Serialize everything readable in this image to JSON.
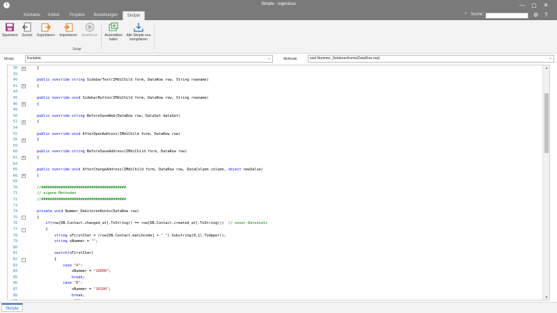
{
  "window": {
    "title": "Skripte - ingenious",
    "controls": {
      "minimize": "—",
      "maximize": "▢",
      "close": "✕"
    }
  },
  "ribbon_tabs": [
    "Kontakte",
    "Artikel",
    "Projekte",
    "Bestellungen",
    "Skripte"
  ],
  "active_tab": "Skripte",
  "search": {
    "label": "Suche:",
    "value": ""
  },
  "ribbon": {
    "buttons": [
      {
        "label": "Speichern",
        "icon": "save-icon"
      },
      {
        "label": "Zurück",
        "icon": "back-icon"
      },
      {
        "label": "Exportieren",
        "icon": "export-icon"
      },
      {
        "label": "Importieren",
        "icon": "import-icon"
      },
      {
        "label": "Ausführen",
        "icon": "run-icon",
        "disabled": true
      },
      {
        "label": "Assemblies laden",
        "icon": "assemblies-icon"
      },
      {
        "label": "Alle Skripte neu kompilieren",
        "icon": "compile-icon"
      }
    ],
    "group_label": "Skript"
  },
  "module": {
    "label": "Modul",
    "value": "Kontakte"
  },
  "method": {
    "label": "Methode",
    "value": "void Nummer_DebitorenKonto(DataRow row)"
  },
  "code_lines": [
    {
      "n": 36,
      "fold": "+",
      "segs": [
        {
          "t": "{"
        }
      ]
    },
    {
      "n": 39,
      "segs": []
    },
    {
      "n": 40,
      "segs": [
        {
          "t": "public override string ",
          "c": "kw"
        },
        {
          "t": "SidebarText(IMdiChild form, DataRow row, String rowname)"
        }
      ]
    },
    {
      "n": 41,
      "fold": "+",
      "segs": [
        {
          "t": "{"
        }
      ]
    },
    {
      "n": 44,
      "segs": []
    },
    {
      "n": 45,
      "segs": [
        {
          "t": "public override void ",
          "c": "kw"
        },
        {
          "t": "SidebarButton(IMdiChild form, DataRow row, String rowname)"
        }
      ]
    },
    {
      "n": 46,
      "fold": "+",
      "segs": [
        {
          "t": "{"
        }
      ]
    },
    {
      "n": 49,
      "segs": []
    },
    {
      "n": 50,
      "segs": [
        {
          "t": "public override string ",
          "c": "kw"
        },
        {
          "t": "BeforeSaveWeb(DataRow row, DataSet dataSet)"
        }
      ]
    },
    {
      "n": 51,
      "fold": "+",
      "segs": [
        {
          "t": "{"
        }
      ]
    },
    {
      "n": 54,
      "segs": []
    },
    {
      "n": 55,
      "segs": [
        {
          "t": "public override void ",
          "c": "kw"
        },
        {
          "t": "AfterOpenAddress(IMdiChild form, DataRow row)"
        }
      ]
    },
    {
      "n": 56,
      "fold": "+",
      "segs": [
        {
          "t": "{"
        }
      ]
    },
    {
      "n": 59,
      "segs": []
    },
    {
      "n": 60,
      "segs": [
        {
          "t": "public override string ",
          "c": "kw"
        },
        {
          "t": "BeforeSaveAddress(IMdiChild form, DataRow row)"
        }
      ]
    },
    {
      "n": 61,
      "fold": "+",
      "segs": [
        {
          "t": "{"
        }
      ]
    },
    {
      "n": 64,
      "segs": []
    },
    {
      "n": 65,
      "segs": [
        {
          "t": "public override void ",
          "c": "kw"
        },
        {
          "t": "AfterChangeAddress(IMdiChild form, DataRow row, DataColumn column, "
        },
        {
          "t": "object",
          "c": "kw"
        },
        {
          "t": " newValue)"
        }
      ]
    },
    {
      "n": 66,
      "fold": "+",
      "segs": [
        {
          "t": "{"
        }
      ]
    },
    {
      "n": 69,
      "segs": []
    },
    {
      "n": 70,
      "segs": [
        {
          "t": "//#######################################",
          "c": "com"
        }
      ]
    },
    {
      "n": 71,
      "segs": [
        {
          "t": "// eigene Methoden",
          "c": "com"
        }
      ]
    },
    {
      "n": 72,
      "segs": [
        {
          "t": "//#######################################",
          "c": "com"
        }
      ]
    },
    {
      "n": 73,
      "segs": []
    },
    {
      "n": 74,
      "segs": [
        {
          "t": "private void ",
          "c": "kw"
        },
        {
          "t": "Nummer_DebitorenKonto(DataRow row)"
        }
      ]
    },
    {
      "n": 75,
      "fold": "-",
      "segs": [
        {
          "t": "{"
        }
      ]
    },
    {
      "n": 76,
      "segs": [
        {
          "t": "    if",
          "c": "kw"
        },
        {
          "t": "(row[DB.Contact.changed_at].ToString() == row[DB.Contact.created_at].ToString())  "
        },
        {
          "t": "// neuer Datensatz",
          "c": "com"
        }
      ]
    },
    {
      "n": 77,
      "fold": "-",
      "segs": [
        {
          "t": "    {"
        }
      ]
    },
    {
      "n": 78,
      "segs": [
        {
          "t": "        string ",
          "c": "kw"
        },
        {
          "t": "sFirstChar = (row[DB.Contact.matchcode] + "
        },
        {
          "t": "\" \"",
          "c": "str"
        },
        {
          "t": ").Substring(0,1).ToUpper();"
        }
      ]
    },
    {
      "n": 79,
      "segs": [
        {
          "t": "        string ",
          "c": "kw"
        },
        {
          "t": "sNummer = "
        },
        {
          "t": "\"\"",
          "c": "str"
        },
        {
          "t": ";"
        }
      ]
    },
    {
      "n": 80,
      "segs": []
    },
    {
      "n": 81,
      "segs": [
        {
          "t": "        switch",
          "c": "kw"
        },
        {
          "t": "(sFirstChar)"
        }
      ]
    },
    {
      "n": 82,
      "fold": "-",
      "segs": [
        {
          "t": "        {"
        }
      ]
    },
    {
      "n": 83,
      "segs": [
        {
          "t": "            case ",
          "c": "kw"
        },
        {
          "t": "\"A\"",
          "c": "str"
        },
        {
          "t": ":"
        }
      ]
    },
    {
      "n": 84,
      "segs": [
        {
          "t": "                sNummer = "
        },
        {
          "t": "\"10000\"",
          "c": "str"
        },
        {
          "t": ";"
        }
      ]
    },
    {
      "n": 85,
      "segs": [
        {
          "t": "                break",
          "c": "kw"
        },
        {
          "t": ";"
        }
      ]
    },
    {
      "n": 86,
      "segs": [
        {
          "t": "            case ",
          "c": "kw"
        },
        {
          "t": "\"B\"",
          "c": "str"
        },
        {
          "t": ":"
        }
      ]
    },
    {
      "n": 87,
      "segs": [
        {
          "t": "                sNummer = "
        },
        {
          "t": "\"10100\"",
          "c": "str"
        },
        {
          "t": ";"
        }
      ]
    },
    {
      "n": 88,
      "segs": [
        {
          "t": "                break",
          "c": "kw"
        },
        {
          "t": ";"
        }
      ]
    },
    {
      "n": 89,
      "segs": [
        {
          "t": "            case ",
          "c": "kw"
        },
        {
          "t": "\"C\"",
          "c": "str"
        },
        {
          "t": ":"
        }
      ]
    },
    {
      "n": 90,
      "segs": [
        {
          "t": "                sNummer = "
        },
        {
          "t": "\"10200\"",
          "c": "str"
        },
        {
          "t": ";"
        }
      ]
    },
    {
      "n": 91,
      "segs": [
        {
          "t": "                break",
          "c": "kw"
        },
        {
          "t": ";"
        }
      ]
    },
    {
      "n": 92,
      "segs": [
        {
          "t": "            case ",
          "c": "kw"
        },
        {
          "t": "\"D\"",
          "c": "str"
        },
        {
          "t": ":"
        }
      ]
    }
  ],
  "bottom_tabs": [
    "Skripte"
  ],
  "colors": {
    "titlebar": "#7a7a7a",
    "keyword": "#0000ff",
    "comment": "#008000",
    "string": "#a31515",
    "line_number": "#2b91af",
    "accent": "#2a6fb0"
  }
}
